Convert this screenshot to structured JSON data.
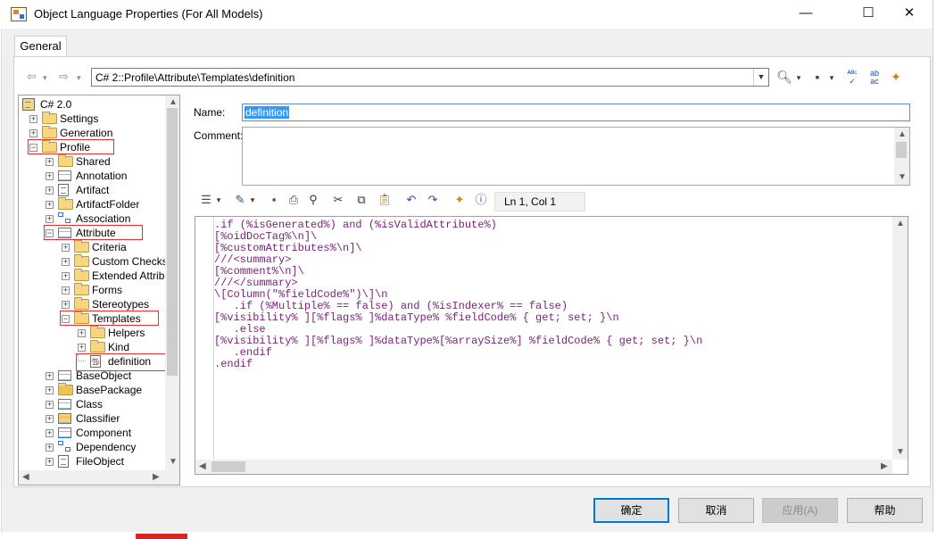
{
  "window": {
    "title": "Object Language Properties (For All Models)",
    "controls": {
      "minimize": "—",
      "maximize": "☐",
      "close": "✕"
    }
  },
  "tabs": [
    {
      "label": "General",
      "active": true
    }
  ],
  "nav": {
    "back_glyph": "⇦",
    "forward_glyph": "⇨",
    "dropdown_glyph": "▾",
    "path": "C# 2::Profile\\Attribute\\Templates\\definition",
    "right_icons": [
      "find-icon",
      "save-icon",
      "spellcheck-icon",
      "replace-icon",
      "properties-icon"
    ]
  },
  "tree": {
    "nodes": [
      {
        "label": "C# 2.0",
        "icon": "language-icon",
        "depth": 0,
        "expander": ""
      },
      {
        "label": "Settings",
        "icon": "folder-icon",
        "depth": 1,
        "expander": "+"
      },
      {
        "label": "Generation",
        "icon": "folder-icon",
        "depth": 1,
        "expander": "+"
      },
      {
        "label": "Profile",
        "icon": "folder-open-icon",
        "depth": 1,
        "expander": "−",
        "highlight": true
      },
      {
        "label": "Shared",
        "icon": "folder-icon",
        "depth": 2,
        "expander": "+"
      },
      {
        "label": "Annotation",
        "icon": "table-icon",
        "depth": 2,
        "expander": "+"
      },
      {
        "label": "Artifact",
        "icon": "document-icon",
        "depth": 2,
        "expander": "+"
      },
      {
        "label": "ArtifactFolder",
        "icon": "folder-icon",
        "depth": 2,
        "expander": "+"
      },
      {
        "label": "Association",
        "icon": "association-icon",
        "depth": 2,
        "expander": "+"
      },
      {
        "label": "Attribute",
        "icon": "table-icon",
        "depth": 2,
        "expander": "−",
        "highlight": true
      },
      {
        "label": "Criteria",
        "icon": "folder-icon",
        "depth": 3,
        "expander": "+"
      },
      {
        "label": "Custom Checks",
        "icon": "folder-icon",
        "depth": 3,
        "expander": "+"
      },
      {
        "label": "Extended Attributes",
        "icon": "folder-icon",
        "depth": 3,
        "expander": "+"
      },
      {
        "label": "Forms",
        "icon": "folder-icon",
        "depth": 3,
        "expander": "+"
      },
      {
        "label": "Stereotypes",
        "icon": "folder-icon",
        "depth": 3,
        "expander": "+"
      },
      {
        "label": "Templates",
        "icon": "folder-open-icon",
        "depth": 3,
        "expander": "−",
        "highlight": true
      },
      {
        "label": "Helpers",
        "icon": "folder-icon",
        "depth": 4,
        "expander": "+"
      },
      {
        "label": "Kind",
        "icon": "folder-icon",
        "depth": 4,
        "expander": "+"
      },
      {
        "label": "definition",
        "icon": "template-icon",
        "depth": 4,
        "expander": "",
        "highlight": true,
        "selected": true
      },
      {
        "label": "BaseObject",
        "icon": "table-icon",
        "depth": 2,
        "expander": "+"
      },
      {
        "label": "BasePackage",
        "icon": "package-icon",
        "depth": 2,
        "expander": "+"
      },
      {
        "label": "Class",
        "icon": "table-icon",
        "depth": 2,
        "expander": "+"
      },
      {
        "label": "Classifier",
        "icon": "classifier-icon",
        "depth": 2,
        "expander": "+"
      },
      {
        "label": "Component",
        "icon": "component-icon",
        "depth": 2,
        "expander": "+"
      },
      {
        "label": "Dependency",
        "icon": "association-icon",
        "depth": 2,
        "expander": "+"
      },
      {
        "label": "FileObject",
        "icon": "document-icon",
        "depth": 2,
        "expander": "+"
      }
    ]
  },
  "form": {
    "name_label": "Name:",
    "name_value": "definition",
    "comment_label": "Comment:",
    "comment_value": ""
  },
  "editor": {
    "toolbar_icons": [
      "editor-menu-icon",
      "edit-icon",
      "save-icon",
      "print-icon",
      "find-icon",
      "cut-icon",
      "copy-icon",
      "paste-icon",
      "undo-icon",
      "redo-icon",
      "insert-icon",
      "help-icon"
    ],
    "position": "Ln 1, Col 1",
    "lines": [
      ".if (%isGenerated%) and (%isValidAttribute%)",
      "[%oidDocTag%\\n]\\",
      "[%customAttributes%\\n]\\",
      "///<summary>",
      "[%comment%\\n]\\",
      "///</summary>",
      "\\[Column(\"%fieldCode%\")\\]\\n",
      "   .if (%Multiple% == false) and (%isIndexer% == false)",
      "[%visibility% ][%flags% ]%dataType% %fieldCode% { get; set; }\\n",
      "   .else",
      "[%visibility% ][%flags% ]%dataType%[%arraySize%] %fieldCode% { get; set; }\\n",
      "   .endif",
      ".endif"
    ]
  },
  "buttons": {
    "ok": "确定",
    "cancel": "取消",
    "apply": "应用(A)",
    "help": "帮助"
  },
  "colors": {
    "accent": "#0078d7",
    "highlight_box": "#e03030",
    "code_keyword": "#7b1e78",
    "selection": "#3399ff"
  }
}
